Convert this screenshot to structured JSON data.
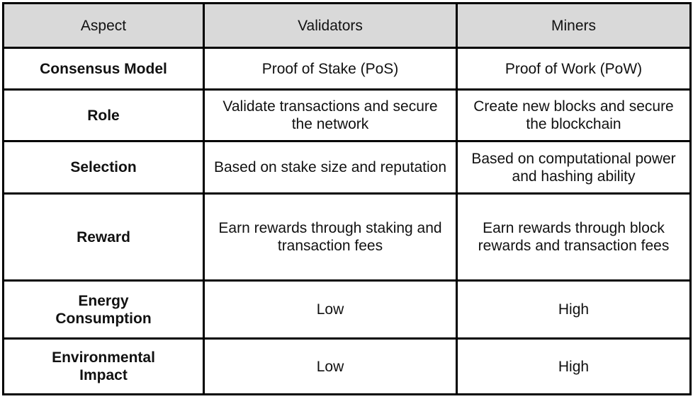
{
  "table": {
    "headers": [
      "Aspect",
      "Validators",
      "Miners"
    ],
    "rows": [
      {
        "aspect": "Consensus Model",
        "validators": "Proof of Stake (PoS)",
        "miners": "Proof of Work (PoW)"
      },
      {
        "aspect": "Role",
        "validators": "Validate transactions and secure the network",
        "miners": "Create new blocks and secure the blockchain"
      },
      {
        "aspect": "Selection",
        "validators": "Based on stake size and reputation",
        "miners": "Based on computational power and hashing ability"
      },
      {
        "aspect": "Reward",
        "validators": "Earn rewards through staking and transaction fees",
        "miners": "Earn rewards through block rewards and transaction fees"
      },
      {
        "aspect": "Energy Consumption",
        "validators": "Low",
        "miners": "High"
      },
      {
        "aspect": "Environmental Impact",
        "validators": "Low",
        "miners": "High"
      }
    ]
  },
  "colors": {
    "header_bg": "#d9d9d9",
    "border": "#000000"
  }
}
